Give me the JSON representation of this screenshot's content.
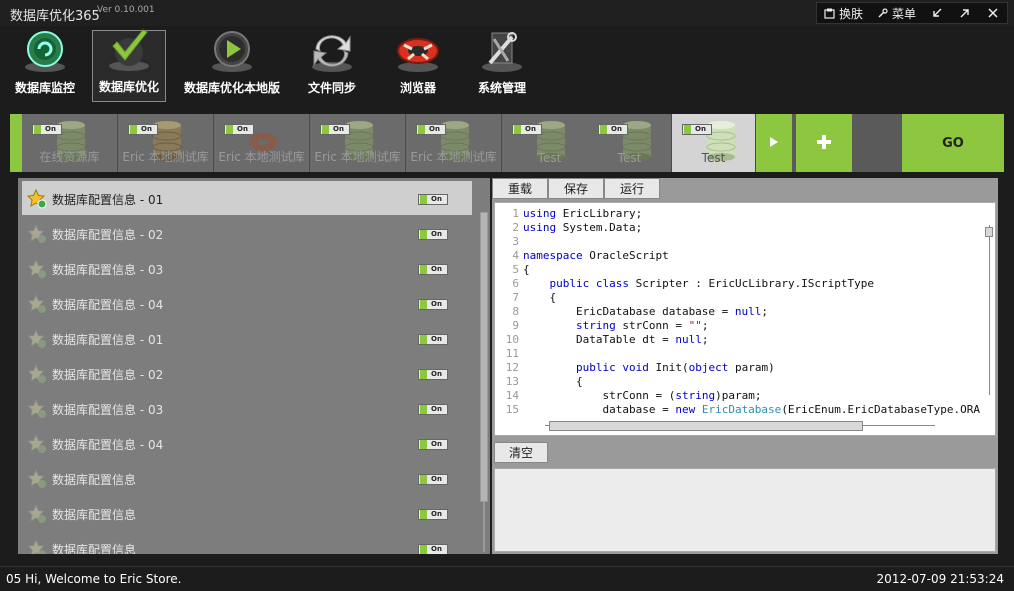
{
  "titlebar": {
    "title": "数据库优化365",
    "version": "Ver 0.10.001",
    "buttons": {
      "skin": "换肤",
      "menu": "菜单"
    }
  },
  "toolbar": {
    "items": [
      {
        "label": "数据库监控",
        "icon": "db-monitor-icon"
      },
      {
        "label": "数据库优化",
        "icon": "checkmark-icon"
      },
      {
        "label": "数据库优化本地版",
        "icon": "play-icon"
      },
      {
        "label": "文件同步",
        "icon": "sync-icon"
      },
      {
        "label": "浏览器",
        "icon": "browser-icon"
      },
      {
        "label": "系统管理",
        "icon": "tools-icon"
      }
    ]
  },
  "db_tabs": {
    "toggle_label": "On",
    "go_label": "GO",
    "items": [
      {
        "name": "在线资源库"
      },
      {
        "name": "Eric 本地测试库"
      },
      {
        "name": "Eric 本地测试库"
      },
      {
        "name": "Eric 本地测试库"
      },
      {
        "name": "Eric 本地测试库"
      },
      {
        "name": "Test"
      },
      {
        "name": "Test"
      },
      {
        "name": "Test"
      }
    ]
  },
  "config_list": {
    "toggle_label": "On",
    "items": [
      {
        "label": "数据库配置信息 - 01"
      },
      {
        "label": "数据库配置信息 - 02"
      },
      {
        "label": "数据库配置信息 - 03"
      },
      {
        "label": "数据库配置信息 - 04"
      },
      {
        "label": "数据库配置信息 - 01"
      },
      {
        "label": "数据库配置信息 - 02"
      },
      {
        "label": "数据库配置信息 - 03"
      },
      {
        "label": "数据库配置信息 - 04"
      },
      {
        "label": "数据库配置信息"
      },
      {
        "label": "数据库配置信息"
      },
      {
        "label": "数据库配置信息"
      }
    ]
  },
  "editor": {
    "buttons": {
      "reload": "重载",
      "save": "保存",
      "run": "运行"
    },
    "clear_label": "清空",
    "lines": [
      "1",
      "2",
      "3",
      "4",
      "5",
      "6",
      "7",
      "8",
      "9",
      "10",
      "11",
      "12",
      "13",
      "14",
      "15"
    ]
  },
  "statusbar": {
    "message": "05 Hi, Welcome to Eric Store.",
    "datetime": "2012-07-09 21:53:24"
  },
  "colors": {
    "accent": "#8dc63f",
    "background": "#1c1c1c"
  }
}
